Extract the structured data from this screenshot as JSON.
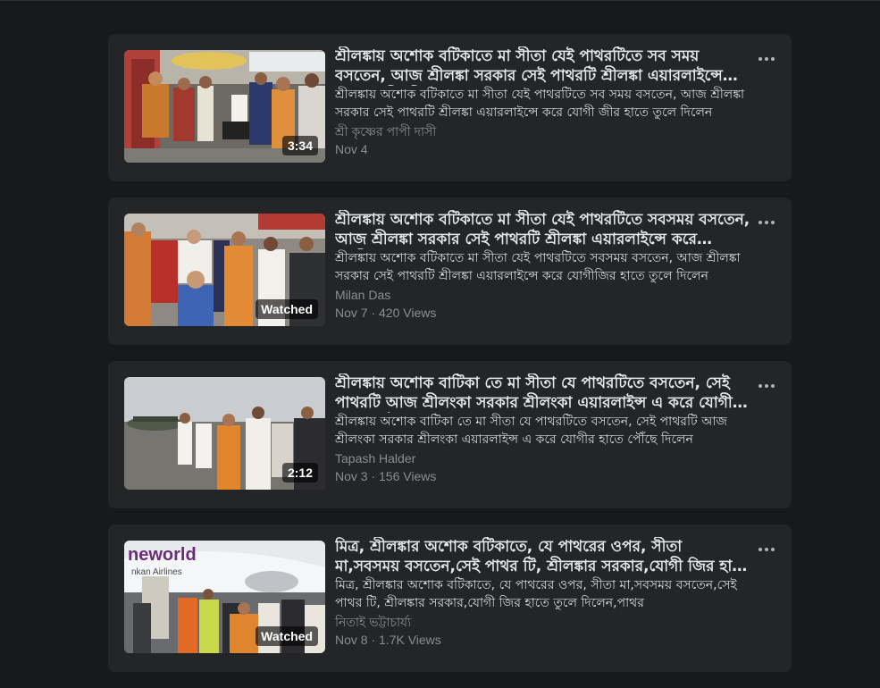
{
  "videos": [
    {
      "title": "শ্রীলঙ্কায় অশোক বটিকাতে মা সীতা যেই পাথরটিতে সব সময় বসতেন, আজ শ্রীলঙ্কা সরকার সেই পাথরটি শ্রীলঙ্কা এয়ারলাইন্সে করে যোগী জীর হাতে তুলে দিলেন",
      "description": "শ্রীলঙ্কায় অশোক বটিকাতে মা সীতা যেই পাথরটিতে সব সময় বসতেন, আজ শ্রীলঙ্কা সরকার সেই পাথরটি শ্রীলঙ্কা এয়ারলাইন্সে করে যোগী জীর হাতে তুলে দিলেন",
      "author": "শ্রী কৃষ্ণের পাপী দাসী",
      "meta": "Nov 4",
      "badge": "3:34",
      "thumb_icon": "video-thumbnail"
    },
    {
      "title": "শ্রীলঙ্কায় অশোক বটিকাতে মা সীতা যেই পাথরটিতে সবসময় বসতেন, আজ শ্রীলঙ্কা সরকার সেই পাথরটি শ্রীলঙ্কা এয়ারলাইন্সে করে যোগীজির হাতে তুলে দিলেন",
      "description": "শ্রীলঙ্কায় অশোক বটিকাতে মা সীতা যেই পাথরটিতে সবসময় বসতেন, আজ শ্রীলঙ্কা সরকার সেই পাথরটি শ্রীলঙ্কা এয়ারলাইন্সে করে যোগীজির হাতে তুলে দিলেন",
      "author": "Milan Das",
      "meta": "Nov 7 · 420 Views",
      "badge": "Watched",
      "thumb_icon": "video-thumbnail"
    },
    {
      "title": "শ্রীলঙ্কায় অশোক বাটিকা তে মা সীতা যে পাথরটিতে বসতেন, সেই পাথরটি আজ শ্রীলংকা সরকার শ্রীলংকা এয়ারলাইন্স এ করে যোগীর হাতে পৌঁছে দিলেন",
      "description": "শ্রীলঙ্কায় অশোক বাটিকা তে মা সীতা যে পাথরটিতে বসতেন, সেই পাথরটি আজ শ্রীলংকা সরকার শ্রীলংকা এয়ারলাইন্স এ করে যোগীর হাতে পৌঁছে দিলেন",
      "author": "Tapash Halder",
      "meta": "Nov 3 · 156 Views",
      "badge": "2:12",
      "thumb_icon": "video-thumbnail"
    },
    {
      "title": "মিত্র, শ্রীলঙ্কার অশোক বটিকাতে, যে পাথরের ওপর, সীতা মা,সবসময় বসতেন,সেই পাথর টি, শ্রীলঙ্কার সরকার,যোগী জির হাতে তুলে দিলেন",
      "description": "মিত্র, শ্রীলঙ্কার অশোক বটিকাতে, যে পাথরের ওপর, সীতা মা,সবসময় বসতেন,সেই পাথর টি, শ্রীলঙ্কার সরকার,যোগী জির হাতে তুলে দিলেন,পাথর",
      "author": "নিতাই ভট্টাচার্য্য",
      "meta": "Nov 8 · 1.7K Views",
      "badge": "Watched",
      "thumb_icon": "video-thumbnail"
    }
  ],
  "thumbnails": {
    "t4_logo": "neworld",
    "t4_sub": "nkan Airlines"
  },
  "more_icon": "more-options-icon",
  "colors": {
    "background": "#18191a",
    "card": "#242526",
    "title": "#e4e6eb",
    "secondary": "#8a8d91"
  }
}
